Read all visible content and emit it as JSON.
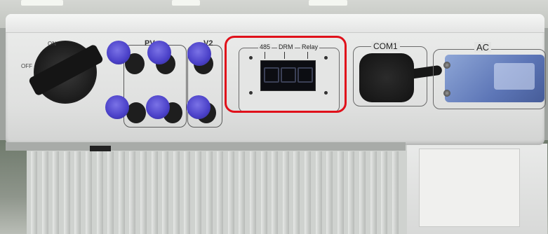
{
  "photo": {
    "switch": {
      "on_label": "ON",
      "off_label": "OFF"
    },
    "pv_group": {
      "pv1_label": "PV",
      "pv2_label": "V2"
    },
    "display_panel": {
      "labels": [
        "485",
        "DRM",
        "Relay"
      ],
      "highlight_color": "#e0111b"
    },
    "com_port": {
      "label": "COM1"
    },
    "ac_port": {
      "label": "AC"
    },
    "colors": {
      "connector_blue": "#4a40c8",
      "ac_cover": "#6a82c2",
      "panel": "#e2e3e2"
    }
  }
}
